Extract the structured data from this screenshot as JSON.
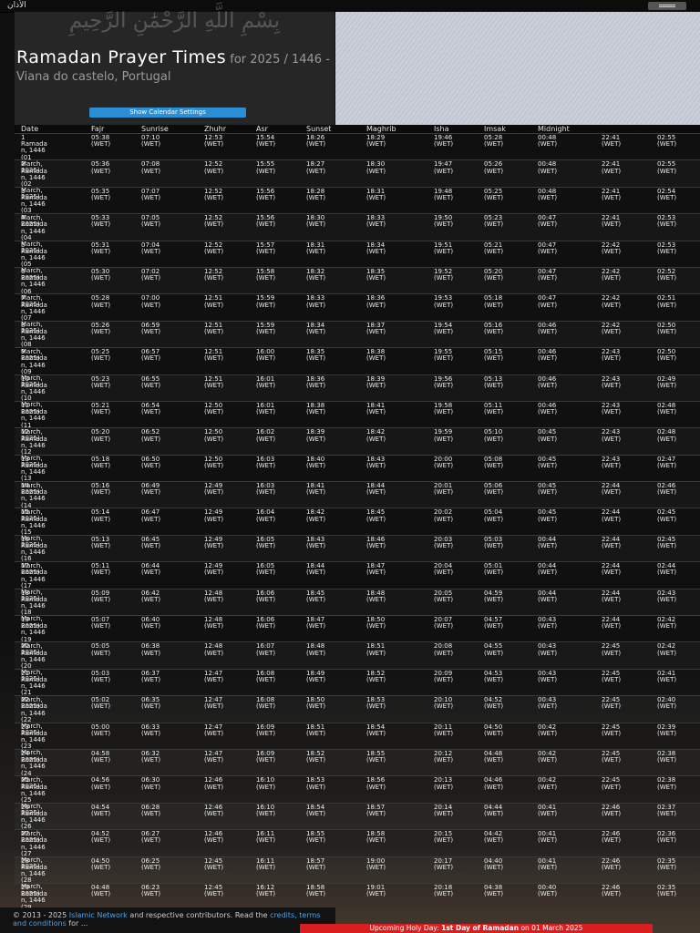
{
  "topbar": {
    "brand": "الأذان",
    "menu_icon": "hamburger-icon"
  },
  "header": {
    "bismillah": "بِسْمِ اللَّهِ الرَّحْمَٰنِ الرَّحِيمِ",
    "title": "Ramadan Prayer Times",
    "subtitle": " for 2025 / 1446 - Viana do castelo, Portugal",
    "settings_button": "Show Calendar Settings"
  },
  "table": {
    "headers": [
      "Date",
      "Fajr",
      "Sunrise",
      "Zhuhr",
      "Asr",
      "Sunset",
      "Maghrib",
      "Isha",
      "Imsak",
      "Midnight",
      "",
      ""
    ],
    "rows": [
      {
        "date": "1 Ramadan, 1446 (01 March, 2025)",
        "t": [
          "05:38 (WET)",
          "07:10 (WET)",
          "12:53 (WET)",
          "15:54 (WET)",
          "18:26 (WET)",
          "18:29 (WET)",
          "19:46 (WET)",
          "05:28 (WET)",
          "00:48 (WET)",
          "22:41 (WET)",
          "02:55 (WET)"
        ]
      },
      {
        "date": "2 Ramadan, 1446 (02 March, 2025)",
        "t": [
          "05:36 (WET)",
          "07:08 (WET)",
          "12:52 (WET)",
          "15:55 (WET)",
          "18:27 (WET)",
          "18:30 (WET)",
          "19:47 (WET)",
          "05:26 (WET)",
          "00:48 (WET)",
          "22:41 (WET)",
          "02:55 (WET)"
        ]
      },
      {
        "date": "3 Ramadan, 1446 (03 March, 2025)",
        "t": [
          "05:35 (WET)",
          "07:07 (WET)",
          "12:52 (WET)",
          "15:56 (WET)",
          "18:28 (WET)",
          "18:31 (WET)",
          "19:48 (WET)",
          "05:25 (WET)",
          "00:48 (WET)",
          "22:41 (WET)",
          "02:54 (WET)"
        ]
      },
      {
        "date": "4 Ramadan, 1446 (04 March, 2025)",
        "t": [
          "05:33 (WET)",
          "07:05 (WET)",
          "12:52 (WET)",
          "15:56 (WET)",
          "18:30 (WET)",
          "18:33 (WET)",
          "19:50 (WET)",
          "05:23 (WET)",
          "00:47 (WET)",
          "22:41 (WET)",
          "02:53 (WET)"
        ]
      },
      {
        "date": "5 Ramadan, 1446 (05 March, 2025)",
        "t": [
          "05:31 (WET)",
          "07:04 (WET)",
          "12:52 (WET)",
          "15:57 (WET)",
          "18:31 (WET)",
          "18:34 (WET)",
          "19:51 (WET)",
          "05:21 (WET)",
          "00:47 (WET)",
          "22:42 (WET)",
          "02:53 (WET)"
        ]
      },
      {
        "date": "6 Ramadan, 1446 (06 March, 2025)",
        "t": [
          "05:30 (WET)",
          "07:02 (WET)",
          "12:52 (WET)",
          "15:58 (WET)",
          "18:32 (WET)",
          "18:35 (WET)",
          "19:52 (WET)",
          "05:20 (WET)",
          "00:47 (WET)",
          "22:42 (WET)",
          "02:52 (WET)"
        ]
      },
      {
        "date": "7 Ramadan, 1446 (07 March, 2025)",
        "t": [
          "05:28 (WET)",
          "07:00 (WET)",
          "12:51 (WET)",
          "15:59 (WET)",
          "18:33 (WET)",
          "18:36 (WET)",
          "19:53 (WET)",
          "05:18 (WET)",
          "00:47 (WET)",
          "22:42 (WET)",
          "02:51 (WET)"
        ]
      },
      {
        "date": "8 Ramadan, 1446 (08 March, 2025)",
        "t": [
          "05:26 (WET)",
          "06:59 (WET)",
          "12:51 (WET)",
          "15:59 (WET)",
          "18:34 (WET)",
          "18:37 (WET)",
          "19:54 (WET)",
          "05:16 (WET)",
          "00:46 (WET)",
          "22:42 (WET)",
          "02:50 (WET)"
        ]
      },
      {
        "date": "9 Ramadan, 1446 (09 March, 2025)",
        "t": [
          "05:25 (WET)",
          "06:57 (WET)",
          "12:51 (WET)",
          "16:00 (WET)",
          "18:35 (WET)",
          "18:38 (WET)",
          "19:55 (WET)",
          "05:15 (WET)",
          "00:46 (WET)",
          "22:43 (WET)",
          "02:50 (WET)"
        ]
      },
      {
        "date": "10 Ramadan, 1446 (10 March, 2025)",
        "t": [
          "05:23 (WET)",
          "06:55 (WET)",
          "12:51 (WET)",
          "16:01 (WET)",
          "18:36 (WET)",
          "18:39 (WET)",
          "19:56 (WET)",
          "05:13 (WET)",
          "00:46 (WET)",
          "22:43 (WET)",
          "02:49 (WET)"
        ]
      },
      {
        "date": "11 Ramadan, 1446 (11 March, 2025)",
        "t": [
          "05:21 (WET)",
          "06:54 (WET)",
          "12:50 (WET)",
          "16:01 (WET)",
          "18:38 (WET)",
          "18:41 (WET)",
          "19:58 (WET)",
          "05:11 (WET)",
          "00:46 (WET)",
          "22:43 (WET)",
          "02:48 (WET)"
        ]
      },
      {
        "date": "12 Ramadan, 1446 (12 March, 2025)",
        "t": [
          "05:20 (WET)",
          "06:52 (WET)",
          "12:50 (WET)",
          "16:02 (WET)",
          "18:39 (WET)",
          "18:42 (WET)",
          "19:59 (WET)",
          "05:10 (WET)",
          "00:45 (WET)",
          "22:43 (WET)",
          "02:48 (WET)"
        ]
      },
      {
        "date": "13 Ramadan, 1446 (13 March, 2025)",
        "t": [
          "05:18 (WET)",
          "06:50 (WET)",
          "12:50 (WET)",
          "16:03 (WET)",
          "18:40 (WET)",
          "18:43 (WET)",
          "20:00 (WET)",
          "05:08 (WET)",
          "00:45 (WET)",
          "22:43 (WET)",
          "02:47 (WET)"
        ]
      },
      {
        "date": "14 Ramadan, 1446 (14 March, 2025)",
        "t": [
          "05:16 (WET)",
          "06:49 (WET)",
          "12:49 (WET)",
          "16:03 (WET)",
          "18:41 (WET)",
          "18:44 (WET)",
          "20:01 (WET)",
          "05:06 (WET)",
          "00:45 (WET)",
          "22:44 (WET)",
          "02:46 (WET)"
        ]
      },
      {
        "date": "15 Ramadan, 1446 (15 March, 2025)",
        "t": [
          "05:14 (WET)",
          "06:47 (WET)",
          "12:49 (WET)",
          "16:04 (WET)",
          "18:42 (WET)",
          "18:45 (WET)",
          "20:02 (WET)",
          "05:04 (WET)",
          "00:45 (WET)",
          "22:44 (WET)",
          "02:45 (WET)"
        ]
      },
      {
        "date": "16 Ramadan, 1446 (16 March, 2025)",
        "t": [
          "05:13 (WET)",
          "06:45 (WET)",
          "12:49 (WET)",
          "16:05 (WET)",
          "18:43 (WET)",
          "18:46 (WET)",
          "20:03 (WET)",
          "05:03 (WET)",
          "00:44 (WET)",
          "22:44 (WET)",
          "02:45 (WET)"
        ]
      },
      {
        "date": "17 Ramadan, 1446 (17 March, 2025)",
        "t": [
          "05:11 (WET)",
          "06:44 (WET)",
          "12:49 (WET)",
          "16:05 (WET)",
          "18:44 (WET)",
          "18:47 (WET)",
          "20:04 (WET)",
          "05:01 (WET)",
          "00:44 (WET)",
          "22:44 (WET)",
          "02:44 (WET)"
        ]
      },
      {
        "date": "18 Ramadan, 1446 (18 March, 2025)",
        "t": [
          "05:09 (WET)",
          "06:42 (WET)",
          "12:48 (WET)",
          "16:06 (WET)",
          "18:45 (WET)",
          "18:48 (WET)",
          "20:05 (WET)",
          "04:59 (WET)",
          "00:44 (WET)",
          "22:44 (WET)",
          "02:43 (WET)"
        ]
      },
      {
        "date": "19 Ramadan, 1446 (19 March, 2025)",
        "t": [
          "05:07 (WET)",
          "06:40 (WET)",
          "12:48 (WET)",
          "16:06 (WET)",
          "18:47 (WET)",
          "18:50 (WET)",
          "20:07 (WET)",
          "04:57 (WET)",
          "00:43 (WET)",
          "22:44 (WET)",
          "02:42 (WET)"
        ]
      },
      {
        "date": "20 Ramadan, 1446 (20 March, 2025)",
        "t": [
          "05:05 (WET)",
          "06:38 (WET)",
          "12:48 (WET)",
          "16:07 (WET)",
          "18:48 (WET)",
          "18:51 (WET)",
          "20:08 (WET)",
          "04:55 (WET)",
          "00:43 (WET)",
          "22:45 (WET)",
          "02:42 (WET)"
        ]
      },
      {
        "date": "21 Ramadan, 1446 (21 March, 2025)",
        "t": [
          "05:03 (WET)",
          "06:37 (WET)",
          "12:47 (WET)",
          "16:08 (WET)",
          "18:49 (WET)",
          "18:52 (WET)",
          "20:09 (WET)",
          "04:53 (WET)",
          "00:43 (WET)",
          "22:45 (WET)",
          "02:41 (WET)"
        ]
      },
      {
        "date": "22 Ramadan, 1446 (22 March, 2025)",
        "t": [
          "05:02 (WET)",
          "06:35 (WET)",
          "12:47 (WET)",
          "16:08 (WET)",
          "18:50 (WET)",
          "18:53 (WET)",
          "20:10 (WET)",
          "04:52 (WET)",
          "00:43 (WET)",
          "22:45 (WET)",
          "02:40 (WET)"
        ]
      },
      {
        "date": "23 Ramadan, 1446 (23 March, 2025)",
        "t": [
          "05:00 (WET)",
          "06:33 (WET)",
          "12:47 (WET)",
          "16:09 (WET)",
          "18:51 (WET)",
          "18:54 (WET)",
          "20:11 (WET)",
          "04:50 (WET)",
          "00:42 (WET)",
          "22:45 (WET)",
          "02:39 (WET)"
        ]
      },
      {
        "date": "24 Ramadan, 1446 (24 March, 2025)",
        "t": [
          "04:58 (WET)",
          "06:32 (WET)",
          "12:47 (WET)",
          "16:09 (WET)",
          "18:52 (WET)",
          "18:55 (WET)",
          "20:12 (WET)",
          "04:48 (WET)",
          "00:42 (WET)",
          "22:45 (WET)",
          "02:38 (WET)"
        ]
      },
      {
        "date": "25 Ramadan, 1446 (25 March, 2025)",
        "t": [
          "04:56 (WET)",
          "06:30 (WET)",
          "12:46 (WET)",
          "16:10 (WET)",
          "18:53 (WET)",
          "18:56 (WET)",
          "20:13 (WET)",
          "04:46 (WET)",
          "00:42 (WET)",
          "22:45 (WET)",
          "02:38 (WET)"
        ]
      },
      {
        "date": "26 Ramadan, 1446 (26 March, 2025)",
        "t": [
          "04:54 (WET)",
          "06:28 (WET)",
          "12:46 (WET)",
          "16:10 (WET)",
          "18:54 (WET)",
          "18:57 (WET)",
          "20:14 (WET)",
          "04:44 (WET)",
          "00:41 (WET)",
          "22:46 (WET)",
          "02:37 (WET)"
        ]
      },
      {
        "date": "27 Ramadan, 1446 (27 March, 2025)",
        "t": [
          "04:52 (WET)",
          "06:27 (WET)",
          "12:46 (WET)",
          "16:11 (WET)",
          "18:55 (WET)",
          "18:58 (WET)",
          "20:15 (WET)",
          "04:42 (WET)",
          "00:41 (WET)",
          "22:46 (WET)",
          "02:36 (WET)"
        ]
      },
      {
        "date": "28 Ramadan, 1446 (28 March, 2025)",
        "t": [
          "04:50 (WET)",
          "06:25 (WET)",
          "12:45 (WET)",
          "16:11 (WET)",
          "18:57 (WET)",
          "19:00 (WET)",
          "20:17 (WET)",
          "04:40 (WET)",
          "00:41 (WET)",
          "22:46 (WET)",
          "02:35 (WET)"
        ]
      },
      {
        "date": "29 Ramadan, 1446 (29 March, 2025)",
        "t": [
          "04:48 (WET)",
          "06:23 (WET)",
          "12:45 (WET)",
          "16:12 (WET)",
          "18:58 (WET)",
          "19:01 (WET)",
          "20:18 (WET)",
          "04:38 (WET)",
          "00:40 (WET)",
          "22:46 (WET)",
          "02:35 (WET)"
        ]
      }
    ]
  },
  "footer": {
    "pre": "© 2013 - 2025 ",
    "link1": "Islamic Network",
    "mid1": " and respective contributors. Read the ",
    "link2": "credits, terms and conditions",
    "mid2": " for ..."
  },
  "holiday": {
    "pre": "Upcoming Holy Day: ",
    "name": "1st Day of Ramadan",
    "post": " on 01 March 2025"
  },
  "colors": {
    "accent": "#2b8fd6",
    "holiday": "#d81e1e",
    "link": "#4ea3e6"
  }
}
